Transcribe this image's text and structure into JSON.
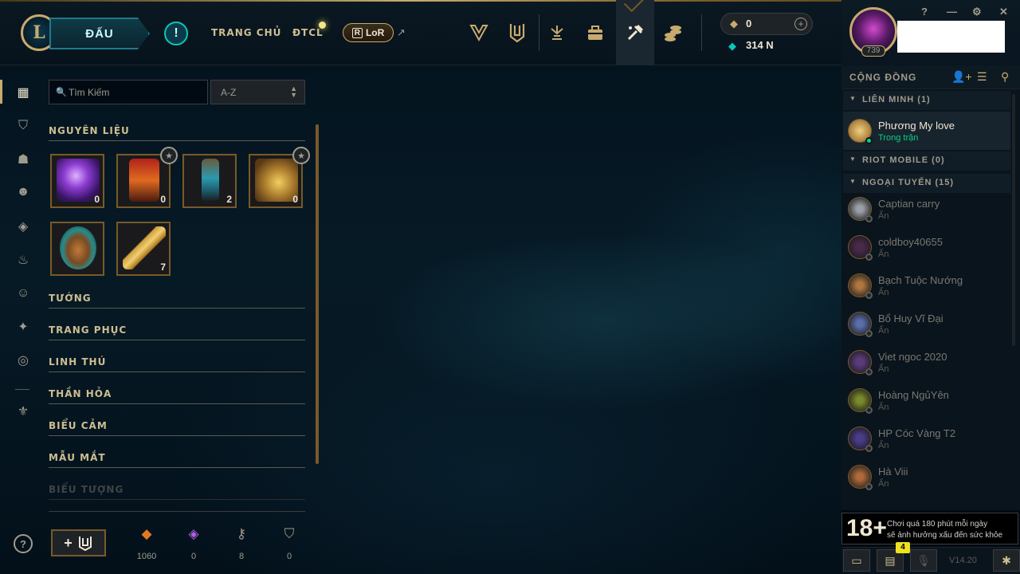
{
  "topbar": {
    "play_label": "ĐẤU",
    "alert_icon": "!",
    "nav": [
      "TRANG CHỦ",
      "ĐTCL"
    ],
    "lor_label": "LoR",
    "lor_r": "R",
    "rp_value": "0",
    "be_value": "314 N"
  },
  "profile": {
    "level": "739"
  },
  "window_controls": [
    "?",
    "—",
    "⚙",
    "✕"
  ],
  "social": {
    "title": "CỘNG ĐỒNG",
    "groups": [
      {
        "label": "LIÊN MINH (1)"
      },
      {
        "label": "RIOT MOBILE (0)"
      },
      {
        "label": "NGOẠI TUYẾN (15)"
      }
    ],
    "online": [
      {
        "name": "Phương My love",
        "status": "Trong trận",
        "color": "#c8aa6e"
      }
    ],
    "offline": [
      {
        "name": "Captian carry",
        "status": "Ẩn",
        "color": "#9aa0a6"
      },
      {
        "name": "coldboy40655",
        "status": "Ẩn",
        "color": "#4a2a4a"
      },
      {
        "name": "Bạch Tuộc Nướng",
        "status": "Ẩn",
        "color": "#b0773f"
      },
      {
        "name": "Bổ Huy Vĩ Đại",
        "status": "Ẩn",
        "color": "#5a6fa8"
      },
      {
        "name": "Viet ngoc 2020",
        "status": "Ẩn",
        "color": "#5b3c7a"
      },
      {
        "name": "Hoàng NgủYên",
        "status": "Ẩn",
        "color": "#7a8a2a"
      },
      {
        "name": "HP Cóc Vàng T2",
        "status": "Ẩn",
        "color": "#4b3c8a"
      },
      {
        "name": "Hà Viii",
        "status": "Ẩn",
        "color": "#b06a3a"
      }
    ]
  },
  "warning": {
    "age": "18+",
    "line1": "Chơi quá 180 phút mỗi ngày",
    "line2": "sẽ ảnh hưởng xấu đến sức khỏe"
  },
  "bottom": {
    "badge": "4",
    "version": "V14.20"
  },
  "loot": {
    "search_placeholder": "Tìm Kiếm",
    "sort_value": "A-Z",
    "sections": [
      "NGUYÊN LIỆU",
      "TƯỚNG",
      "TRANG PHỤC",
      "LINH THÚ",
      "THẦN HỎA",
      "BIỂU CẢM",
      "MẪU MẮT",
      "BIỂU TƯỢNG"
    ],
    "materials": [
      {
        "count": "0",
        "art": "purple-gem",
        "starred": false
      },
      {
        "count": "0",
        "art": "fire-chest",
        "starred": true
      },
      {
        "count": "2",
        "art": "lantern",
        "starred": false
      },
      {
        "count": "0",
        "art": "golden-chest",
        "starred": true
      },
      {
        "count": "",
        "art": "mystery-egg",
        "starred": false
      },
      {
        "count": "7",
        "art": "hextech-key",
        "starred": false
      }
    ],
    "resources": [
      {
        "icon": "orange-essence-icon",
        "value": "1060"
      },
      {
        "icon": "mythic-essence-icon",
        "value": "0"
      },
      {
        "icon": "key-fragment-icon",
        "value": "8"
      },
      {
        "icon": "chest-icon",
        "value": "0"
      }
    ]
  },
  "colors": {
    "gold": "#c8aa6e",
    "teal": "#0ac8b9",
    "online_green": "#0acf83"
  }
}
